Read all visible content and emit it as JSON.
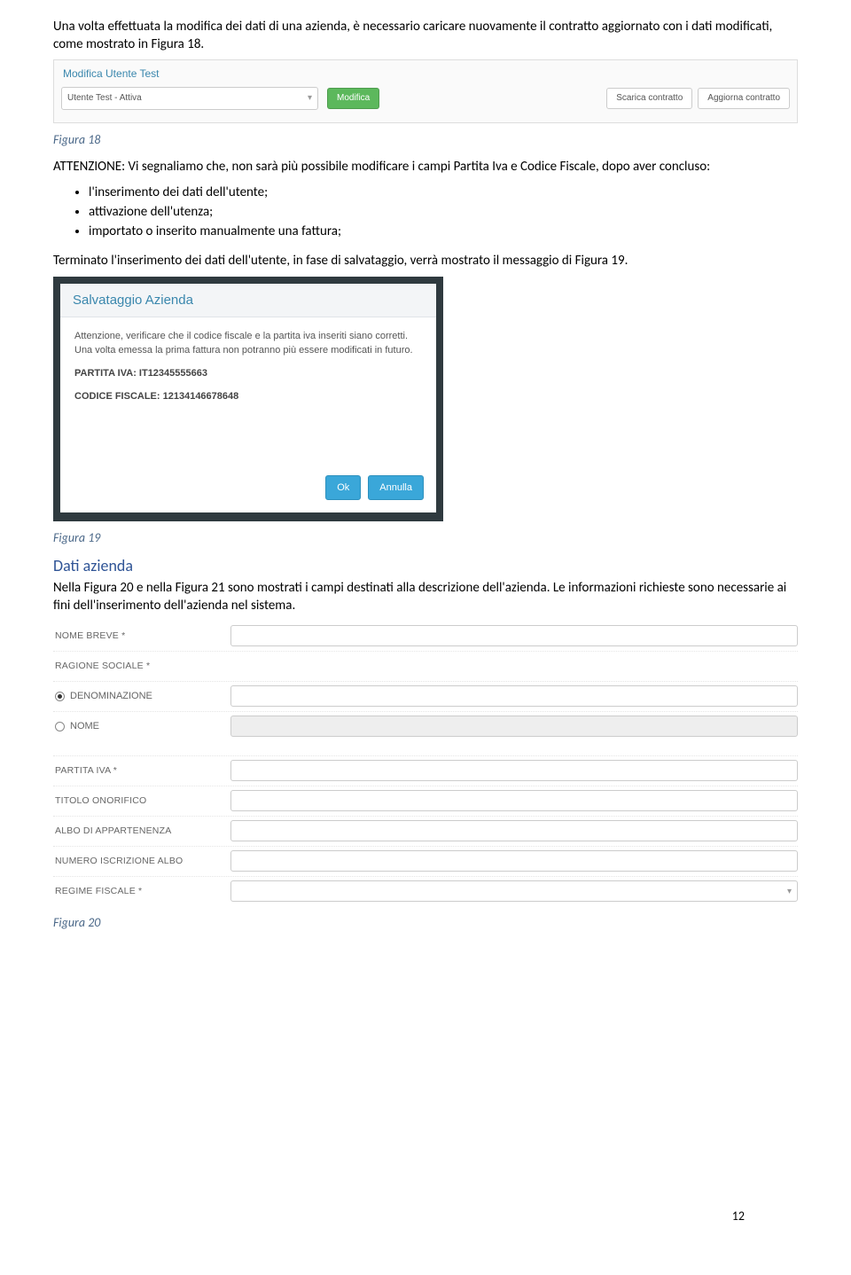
{
  "p1": "Una volta effettuata la modifica dei dati di una azienda, è necessario caricare nuovamente il contratto aggiornato con i dati modificati, come mostrato in Figura 18.",
  "sshot1": {
    "title": "Modifica Utente Test",
    "select_value": "Utente Test - Attiva",
    "btn_modifica": "Modifica",
    "btn_scarica": "Scarica contratto",
    "btn_aggiorna": "Aggiorna contratto"
  },
  "fig18": "Figura 18",
  "p2": "ATTENZIONE: Vi segnaliamo che, non sarà più possibile modificare i campi Partita Iva e Codice Fiscale, dopo aver concluso:",
  "bullets": {
    "b1": "l'inserimento dei dati dell'utente;",
    "b2": "attivazione dell'utenza;",
    "b3": "importato o inserito manualmente una fattura;"
  },
  "p3": "Terminato l'inserimento dei dati dell'utente, in fase di salvataggio, verrà mostrato il messaggio di Figura 19.",
  "modal": {
    "title": "Salvataggio Azienda",
    "body": "Attenzione, verificare che il codice fiscale e la partita iva inseriti siano corretti. Una volta emessa la prima fattura non potranno più essere modificati in futuro.",
    "piva_label": "PARTITA IVA: IT12345555663",
    "cf_label": "CODICE FISCALE: 12134146678648",
    "ok": "Ok",
    "annulla": "Annulla"
  },
  "fig19": "Figura 19",
  "sec_title": "Dati azienda",
  "p4": "Nella Figura 20 e nella Figura 21 sono mostrati i campi destinati alla descrizione dell'azienda. Le informazioni richieste sono necessarie ai fini dell'inserimento dell'azienda nel sistema.",
  "form": {
    "nome_breve": "NOME BREVE *",
    "ragione_sociale": "RAGIONE SOCIALE *",
    "denominazione": "DENOMINAZIONE",
    "nome": "NOME",
    "partita_iva": "PARTITA IVA *",
    "titolo_onorifico": "TITOLO ONORIFICO",
    "albo": "ALBO DI APPARTENENZA",
    "num_iscr": "NUMERO ISCRIZIONE ALBO",
    "regime": "REGIME FISCALE *"
  },
  "fig20": "Figura 20",
  "page_number": "12"
}
